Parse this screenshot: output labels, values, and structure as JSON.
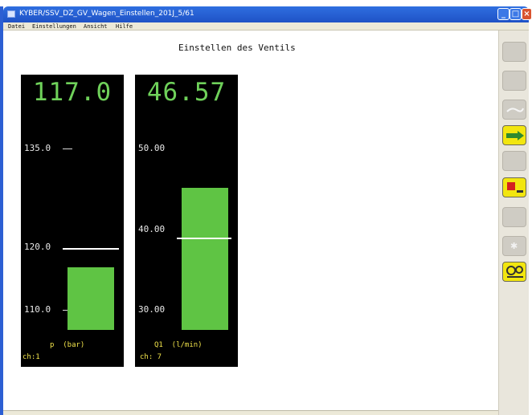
{
  "window": {
    "title": "KYBER/SSV_DZ_GV_Wagen_Einstellen_201J_5/61",
    "min_glyph": "_",
    "max_glyph": "□",
    "close_glyph": "×"
  },
  "menu": {
    "items": [
      "Datei",
      "Einstellungen",
      "Ansicht",
      "Hilfe"
    ]
  },
  "page": {
    "title": "Einstellen des Ventils"
  },
  "gauges": [
    {
      "value": "117.0",
      "ticks": [
        "135.0",
        "120.0",
        "110.0"
      ],
      "unit": "p  (bar)",
      "channel": "ch:1",
      "current": 117.0,
      "setpoint": 120.0,
      "range": [
        107,
        140
      ]
    },
    {
      "value": "46.57",
      "ticks": [
        "50.00",
        "40.00",
        "30.00"
      ],
      "unit": "Q1  (l/min)",
      "channel": "ch: 7",
      "current": 46.57,
      "setpoint": 40.0,
      "range": [
        28,
        55
      ]
    }
  ],
  "toolbar": {
    "buttons": [
      {
        "name": "toolbar-button-1",
        "style": "gray"
      },
      {
        "name": "toolbar-button-2",
        "style": "gray"
      },
      {
        "name": "toolbar-button-3",
        "style": "gray"
      },
      {
        "name": "toolbar-forward-button",
        "style": "yellow",
        "icon": "arrow-right-icon"
      },
      {
        "name": "toolbar-button-5",
        "style": "gray"
      },
      {
        "name": "toolbar-stop-button",
        "style": "yellow",
        "icon": "stop-icon"
      },
      {
        "name": "toolbar-button-7",
        "style": "gray"
      },
      {
        "name": "toolbar-button-8",
        "style": "gray"
      },
      {
        "name": "toolbar-settings-button",
        "style": "yellow",
        "icon": "gears-icon"
      }
    ],
    "colors": {
      "yellow": "#f2e60f",
      "gray": "#cfccc4"
    }
  },
  "colors": {
    "gauge_bg": "#000000",
    "bar": "#5fc444",
    "value_text": "#6fd15a",
    "unit_text": "#f0e24a"
  }
}
